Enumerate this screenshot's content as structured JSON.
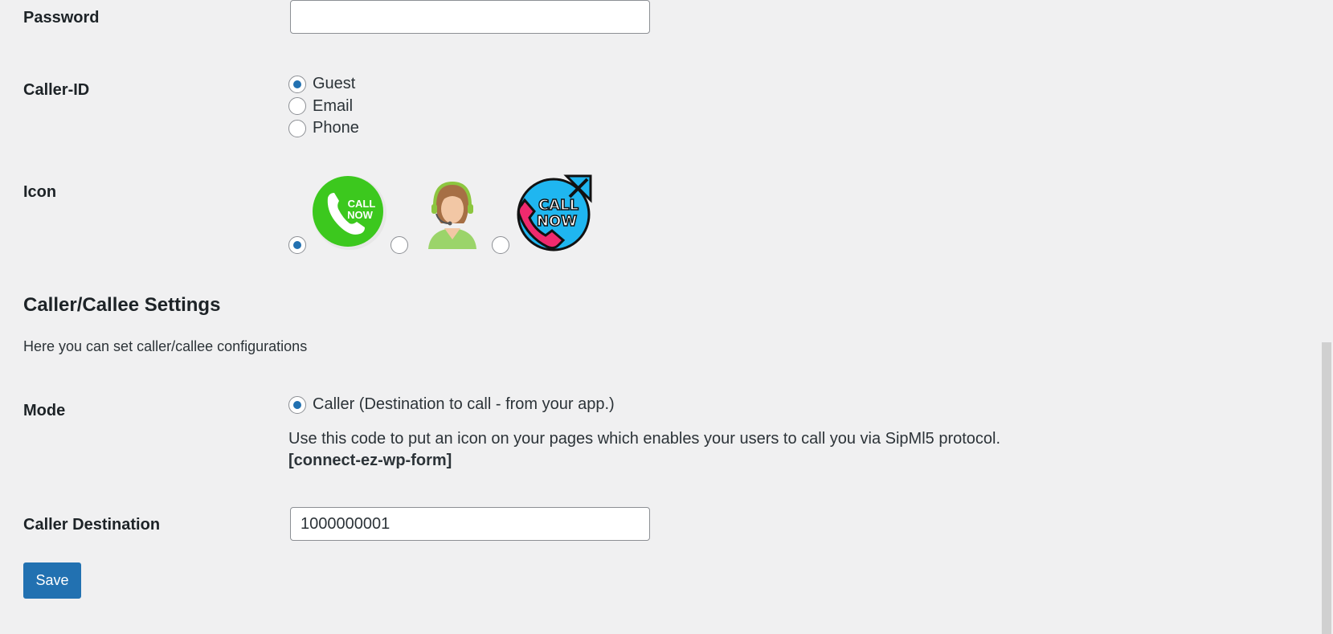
{
  "password": {
    "label": "Password",
    "value": ""
  },
  "caller_id": {
    "label": "Caller-ID",
    "options": [
      "Guest",
      "Email",
      "Phone"
    ],
    "selected": "Guest"
  },
  "icon": {
    "label": "Icon",
    "options": [
      "call-now-green-icon",
      "support-agent-icon",
      "call-now-blue-icon"
    ],
    "selected": "call-now-green-icon",
    "icon1_text_line1": "CALL",
    "icon1_text_line2": "NOW",
    "icon3_text_line1": "CALL",
    "icon3_text_line2": "NOW"
  },
  "section": {
    "title": "Caller/Callee Settings",
    "description": "Here you can set caller/callee configurations"
  },
  "mode": {
    "label": "Mode",
    "option_label": "Caller (Destination to call - from your app.)",
    "help": "Use this code to put an icon on your pages which enables your users to call you via SipMl5 protocol.",
    "shortcode": "[connect-ez-wp-form]"
  },
  "caller_destination": {
    "label": "Caller Destination",
    "value": "1000000001"
  },
  "save_label": "Save",
  "colors": {
    "accent": "#2271b1",
    "background": "#f0f0f1",
    "green": "#3cc81e",
    "blue": "#1fb6f0",
    "pink": "#f02a6e"
  }
}
